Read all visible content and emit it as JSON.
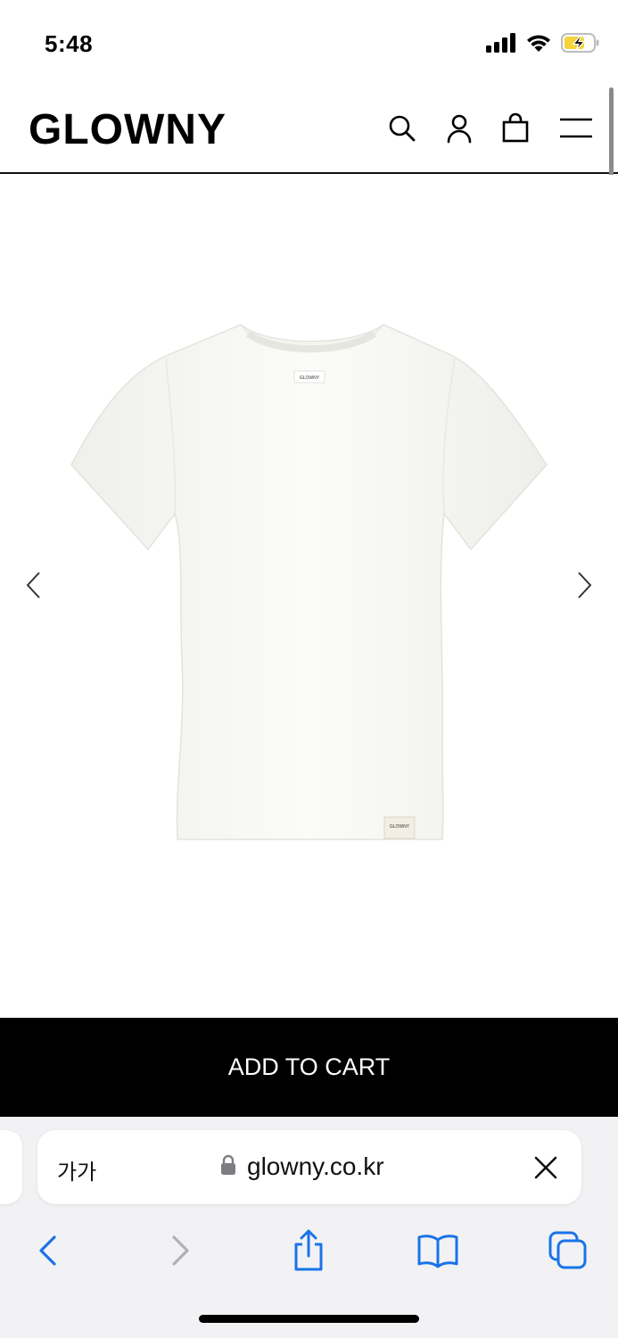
{
  "status_bar": {
    "time": "5:48",
    "icons": [
      "signal-icon",
      "wifi-icon",
      "battery-charging-icon"
    ]
  },
  "header": {
    "logo": "GLOWNY",
    "icons": [
      "search-icon",
      "account-icon",
      "shopping-bag-icon",
      "menu-icon"
    ]
  },
  "product": {
    "image_label": "GLOWNY",
    "gallery_icons": [
      "chevron-left-icon",
      "chevron-right-icon"
    ]
  },
  "cart": {
    "button_label": "ADD TO CART"
  },
  "browser": {
    "text_size_label": "가가",
    "url": "glowny.co.kr",
    "toolbar_icons": [
      "back-icon",
      "forward-icon",
      "share-icon",
      "bookmarks-icon",
      "tabs-icon"
    ]
  },
  "colors": {
    "accent": "#000000",
    "browser_blue": "#1a73e8",
    "battery_yellow": "#f5d33b",
    "disabled_gray": "#b0b0b5"
  }
}
